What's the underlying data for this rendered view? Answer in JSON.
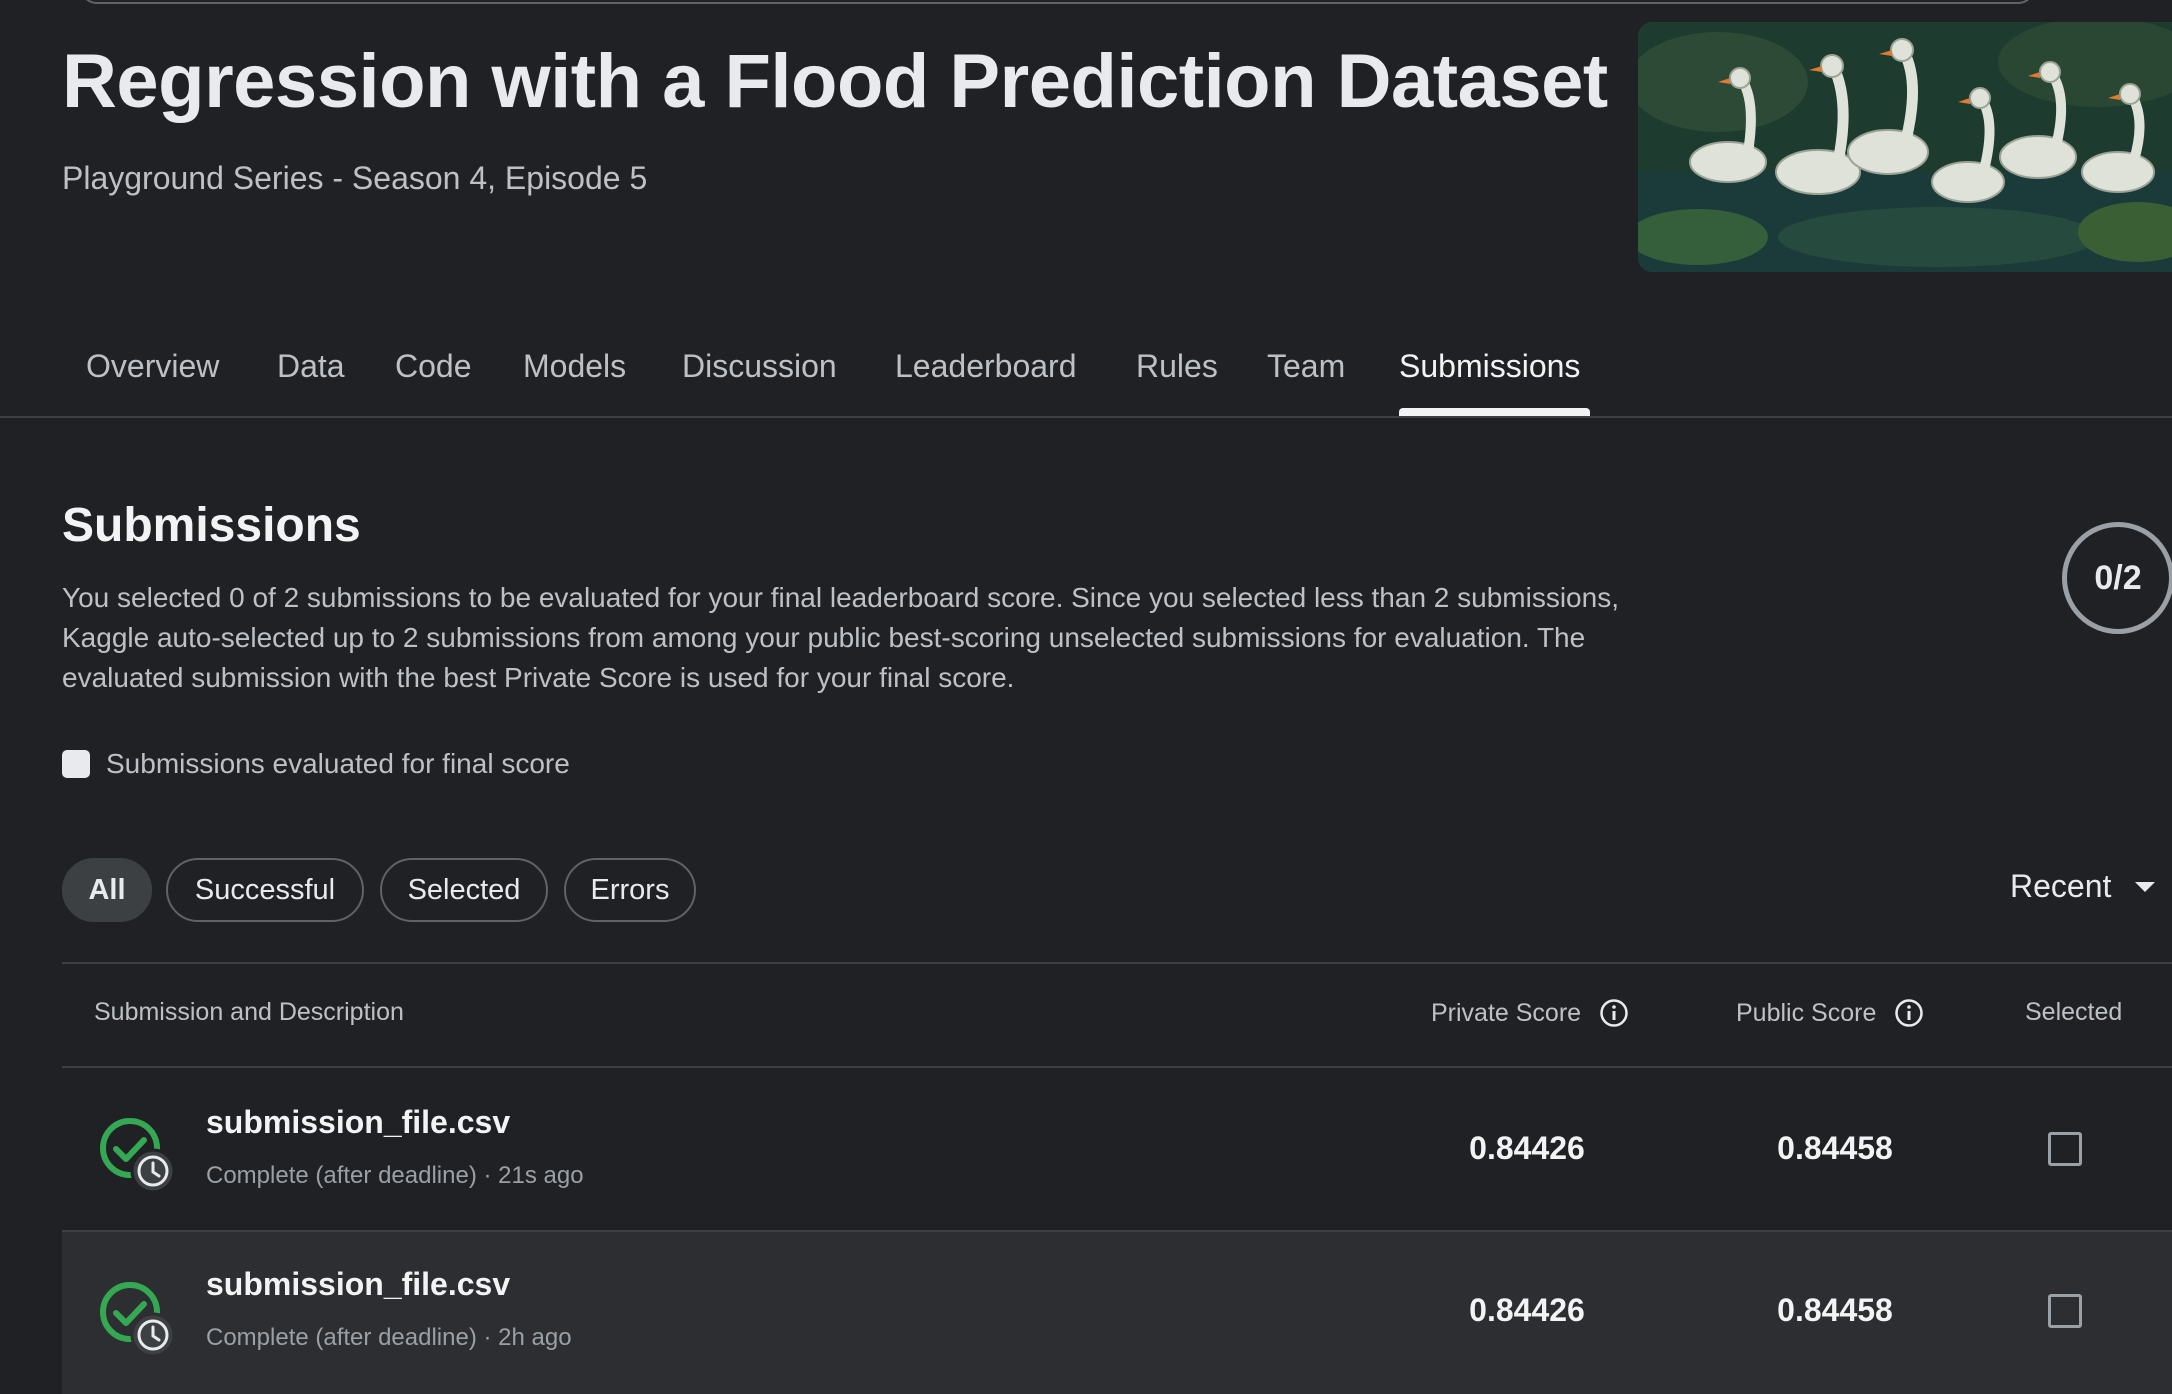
{
  "header": {
    "title": "Regression with a Flood Prediction Dataset",
    "subtitle": "Playground Series - Season 4, Episode 5"
  },
  "tabs": [
    {
      "label": "Overview"
    },
    {
      "label": "Data"
    },
    {
      "label": "Code"
    },
    {
      "label": "Models"
    },
    {
      "label": "Discussion"
    },
    {
      "label": "Leaderboard"
    },
    {
      "label": "Rules"
    },
    {
      "label": "Team"
    },
    {
      "label": "Submissions",
      "active": true
    }
  ],
  "submissions": {
    "title": "Submissions",
    "description": "You selected 0 of 2 submissions to be evaluated for your final leaderboard score. Since you selected less than 2 submissions, Kaggle auto-selected up to 2 submissions from among your public best-scoring unselected submissions for evaluation. The evaluated submission with the best Private Score is used for your final score.",
    "selected_count": "0/2",
    "legend_label": "Submissions evaluated for final score"
  },
  "filters": {
    "chips": [
      "All",
      "Successful",
      "Selected",
      "Errors"
    ],
    "active": "All",
    "sort_label": "Recent"
  },
  "table": {
    "headers": {
      "submission": "Submission and Description",
      "private": "Private Score",
      "public": "Public Score",
      "selected": "Selected"
    },
    "rows": [
      {
        "file": "submission_file.csv",
        "meta": "Complete (after deadline) · 21s ago",
        "private": "0.84426",
        "public": "0.84458",
        "selected": false
      },
      {
        "file": "submission_file.csv",
        "meta": "Complete (after deadline) · 2h ago",
        "private": "0.84426",
        "public": "0.84458",
        "selected": false
      }
    ]
  },
  "colors": {
    "background": "#202124",
    "success_green": "#34a853",
    "text_primary": "#f1f3f4",
    "text_secondary": "#bdc1c6"
  }
}
